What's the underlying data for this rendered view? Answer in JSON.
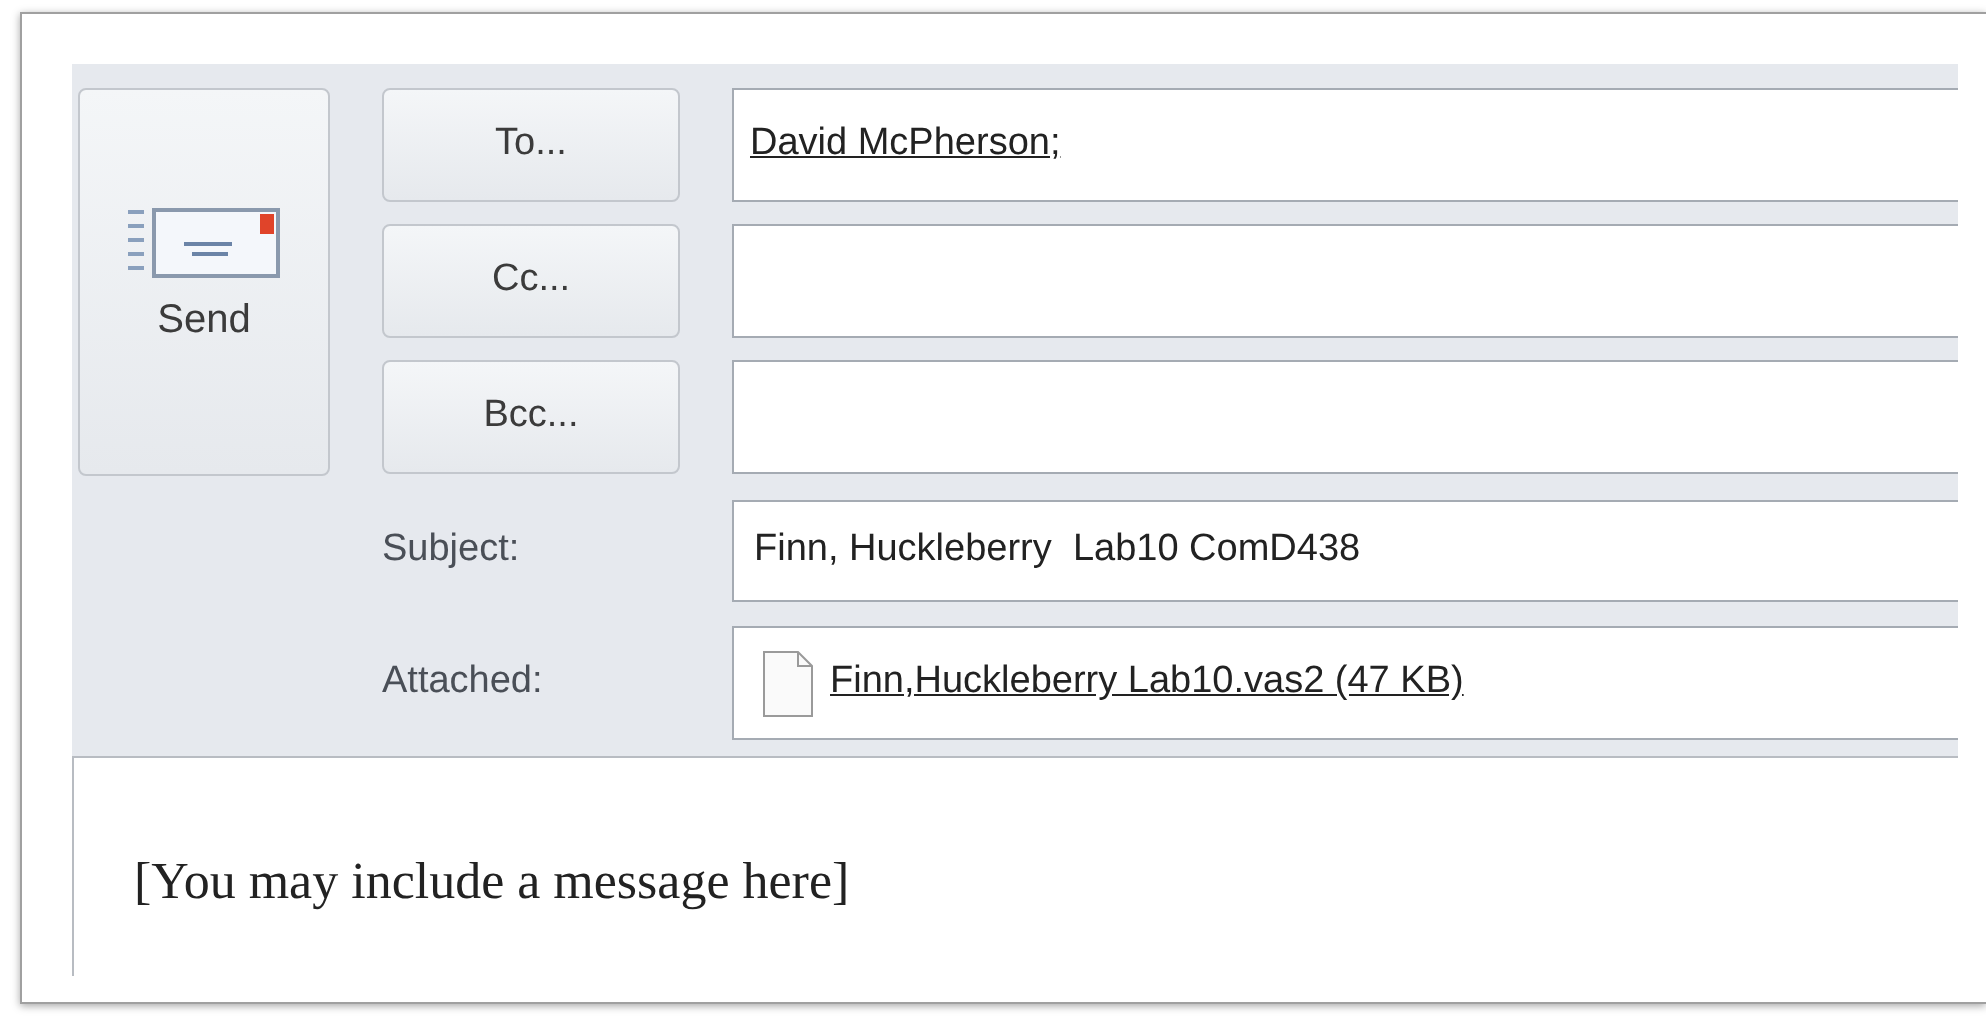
{
  "send_button": {
    "label": "Send"
  },
  "address_rows": [
    {
      "button": "To...",
      "recipients": "David McPherson;"
    },
    {
      "button": "Cc..."
    },
    {
      "button": "Bcc..."
    }
  ],
  "subject": {
    "label": "Subject:",
    "value": "Finn, Huckleberry  Lab10 ComD438"
  },
  "attachment": {
    "label": "Attached:",
    "file": "Finn,Huckleberry Lab10.vas2 (47 KB)"
  },
  "body": {
    "text": "[You may include a message here]"
  }
}
